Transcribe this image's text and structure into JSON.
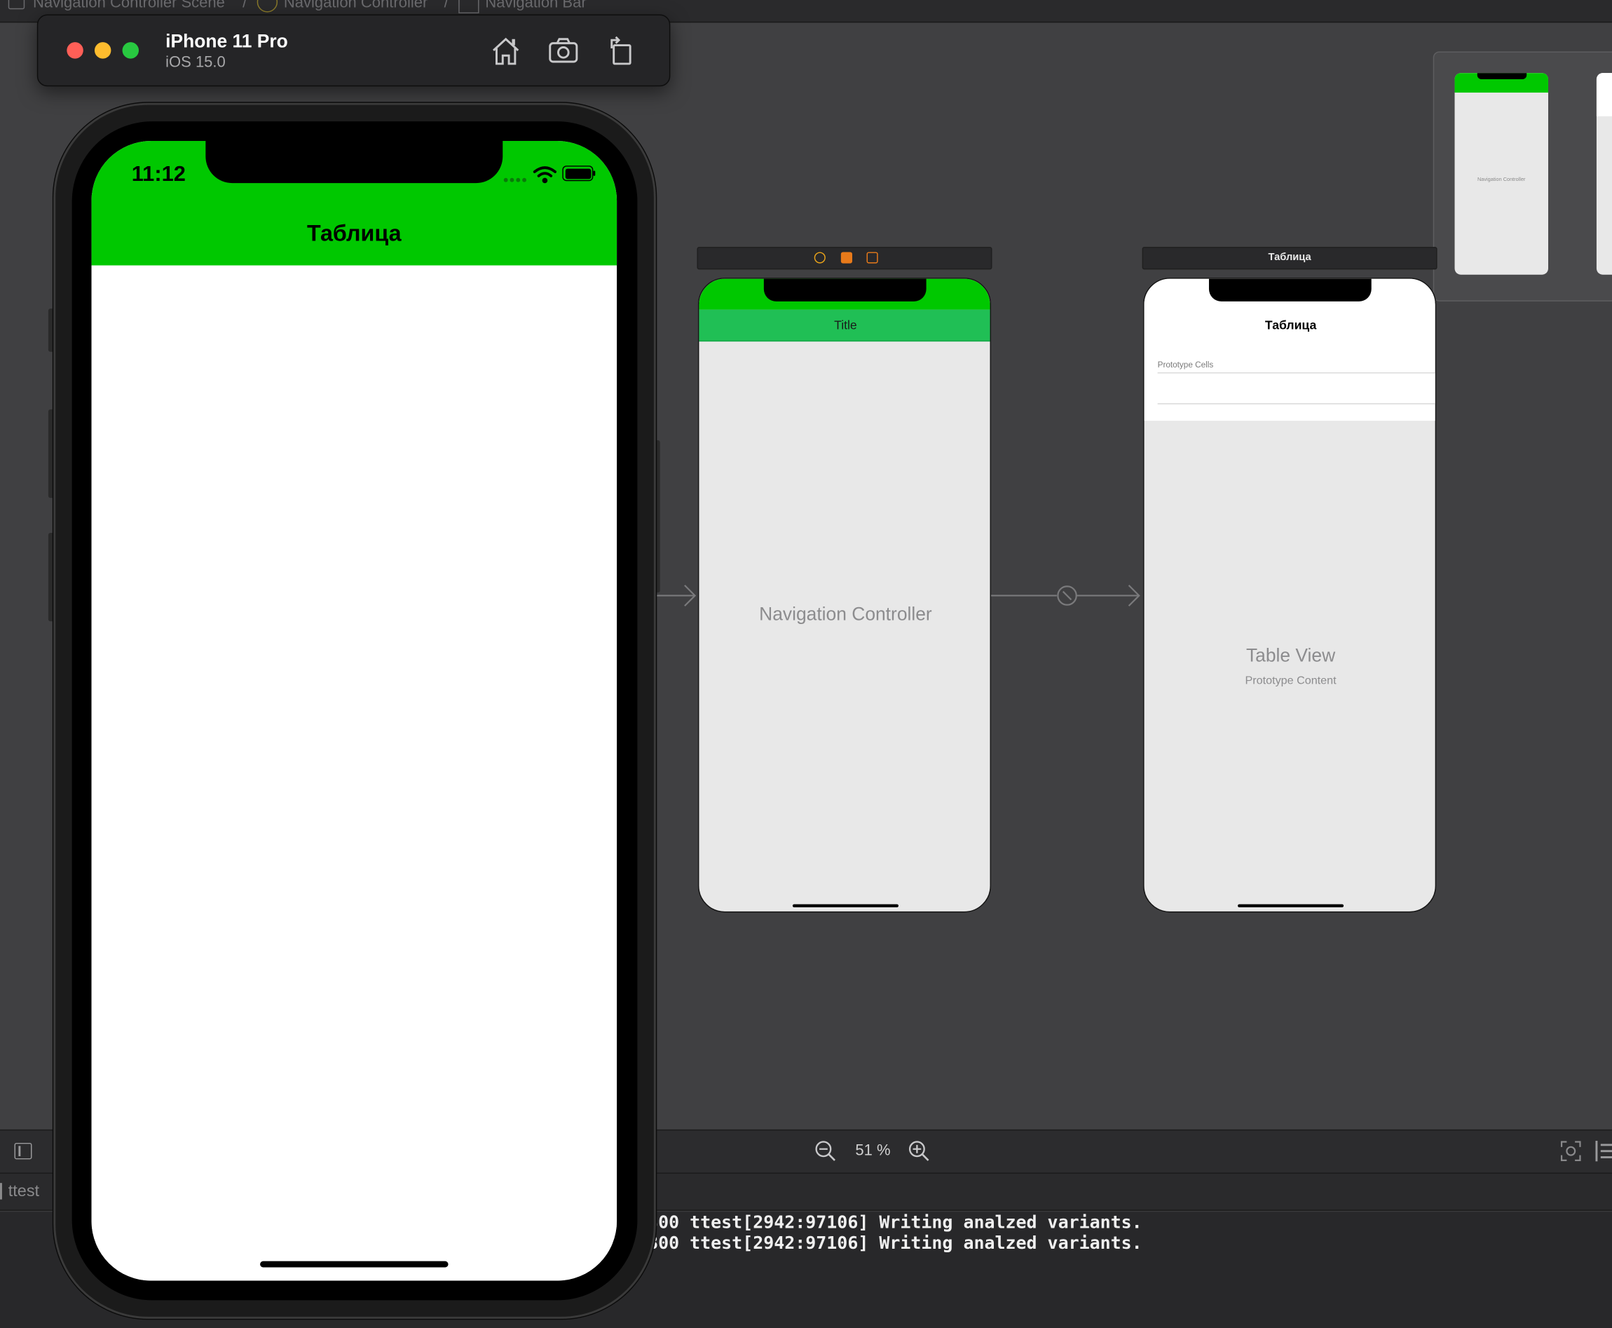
{
  "jumpbar": {
    "crumbs": [
      "Navigation Controller Scene",
      "Navigation Controller",
      "Navigation Bar"
    ]
  },
  "simulator": {
    "device_name": "iPhone 11 Pro",
    "os_version": "iOS 15.0",
    "buttons": [
      "home-icon",
      "screenshot-icon",
      "rotate-icon"
    ]
  },
  "phone": {
    "time": "11:12",
    "nav_title": "Таблица",
    "nav_color": "#00c800"
  },
  "storyboard": {
    "nav_controller": {
      "bar_title": "Title",
      "label": "Navigation Controller"
    },
    "table_scene": {
      "scene_bar_label": "Таблица",
      "nav_title": "Таблица",
      "prototype_cells_label": "Prototype Cells",
      "table_view_label": "Table View",
      "table_view_sub": "Prototype Content"
    },
    "minimap": {
      "label": "Navigation Controller"
    }
  },
  "zoom": {
    "level": "51 %"
  },
  "debug": {
    "target": "ttest",
    "console_lines": [
      "300 ttest[2942:97106] Writing analzed variants.",
      "300 ttest[2942:97106] Writing analzed variants."
    ]
  },
  "colors": {
    "accent_green": "#00c800",
    "nav_bar_green": "#20bf55"
  }
}
